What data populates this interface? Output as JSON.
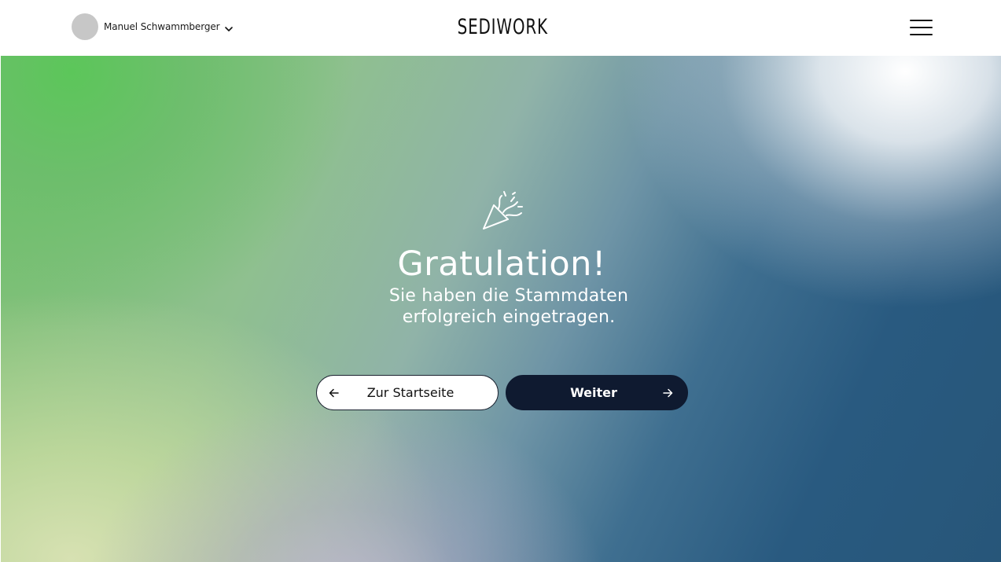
{
  "header": {
    "user_name": "Manuel Schwammberger",
    "logo_text": "SEDIWORK"
  },
  "hero": {
    "title": "Gratulation!",
    "subtitle": "Sie haben die Stammdaten erfolgreich eingetragen."
  },
  "buttons": {
    "back_label": "Zur Startseite",
    "next_label": "Weiter"
  },
  "icons": {
    "avatar": "avatar-circle",
    "user_menu": "chevron-down-icon",
    "menu": "hamburger-menu-icon",
    "success": "party-popper-icon",
    "back": "arrow-left-icon",
    "next": "arrow-right-icon"
  },
  "colors": {
    "primary_button": "#0f1a30",
    "avatar_placeholder": "#c7c7c7",
    "text_dark": "#111111",
    "hero_text": "#ffffff"
  }
}
